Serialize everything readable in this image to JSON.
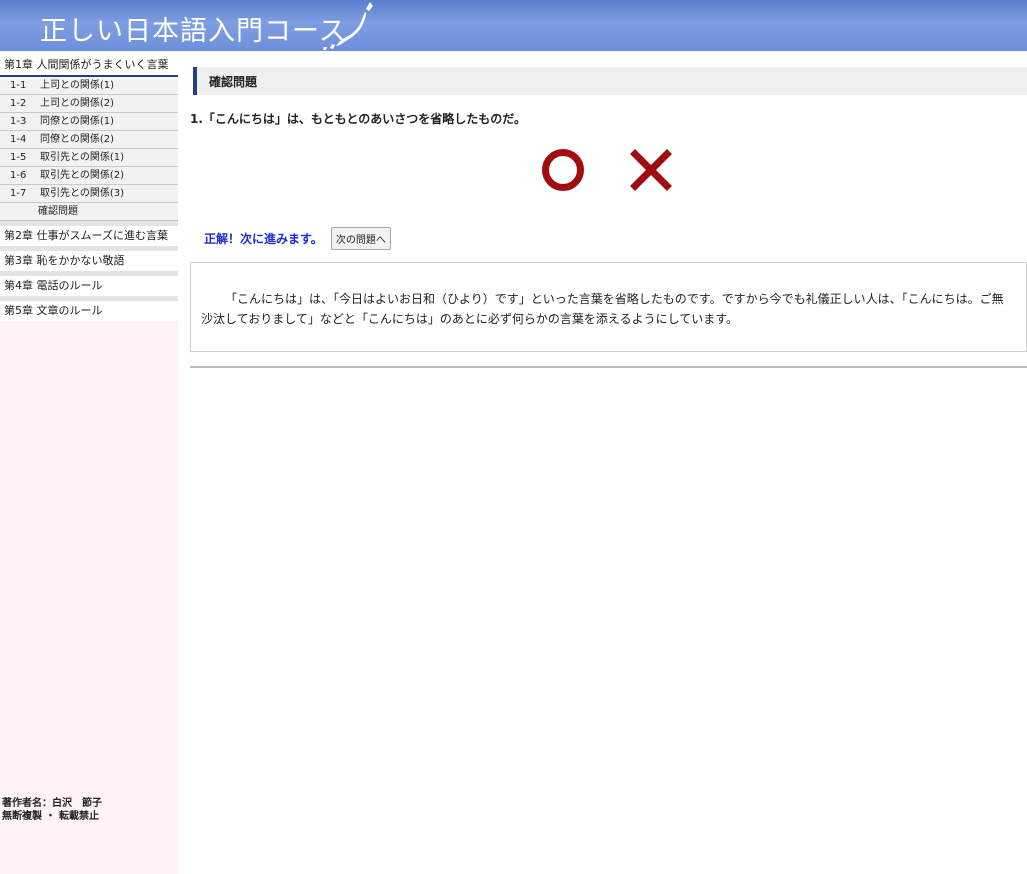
{
  "header": {
    "title": "正しい日本語入門コース"
  },
  "sidebar": {
    "chapters": [
      {
        "label": "第1章 人間関係がうまくいく言葉",
        "items": [
          {
            "num": "1-1",
            "label": "上司との関係(1)"
          },
          {
            "num": "1-2",
            "label": "上司との関係(2)"
          },
          {
            "num": "1-3",
            "label": "同僚との関係(1)"
          },
          {
            "num": "1-4",
            "label": "同僚との関係(2)"
          },
          {
            "num": "1-5",
            "label": "取引先との関係(1)"
          },
          {
            "num": "1-6",
            "label": "取引先との関係(2)"
          },
          {
            "num": "1-7",
            "label": "取引先との関係(3)"
          }
        ],
        "current_item": "確認問題"
      },
      {
        "label": "第2章 仕事がスムーズに進む言葉"
      },
      {
        "label": "第3章 恥をかかない敬語"
      },
      {
        "label": "第4章 電話のルール"
      },
      {
        "label": "第5章 文章のルール"
      }
    ],
    "footer": {
      "author": "著作者名：白沢　節子",
      "copyright": "無断複製 ・ 転載禁止"
    }
  },
  "main": {
    "section_title": "確認問題",
    "question": "1.「こんにちは」は、もともとのあいさつを省略したものだ。",
    "answer_correct_icon": "circle-icon",
    "answer_wrong_icon": "cross-icon",
    "result_text": "正解！次に進みます。",
    "next_button_label": "次の問題へ",
    "explanation": "「こんにちは」は、「今日はよいお日和（ひより）です」といった言葉を省略したものです。ですから今でも礼儀正しい人は、「こんにちは。ご無沙汰しておりまして」などと「こんにちは」のあとに必ず何らかの言葉を添えるようにしています。"
  },
  "colors": {
    "header_blue": "#6d8fdb",
    "nav_accent": "#1f3f86",
    "answer_red": "#a10d0d",
    "result_blue": "#1a2cd6",
    "sidebar_bg": "#fff3f3"
  }
}
